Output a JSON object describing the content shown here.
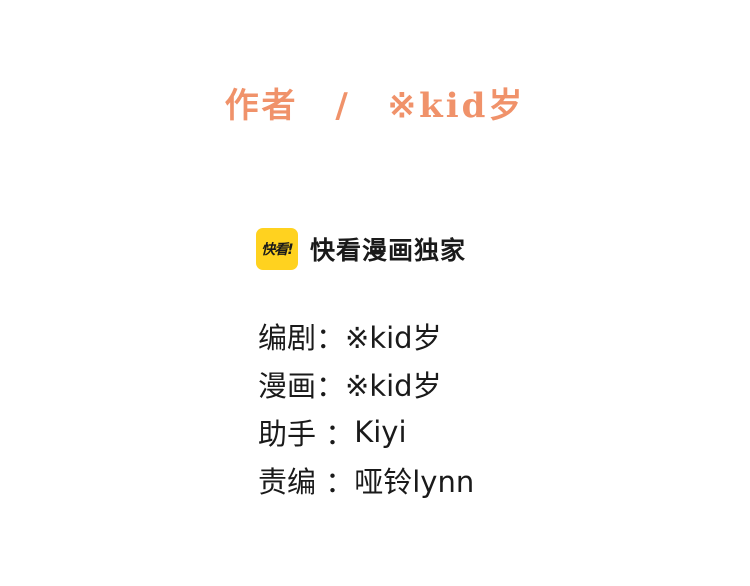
{
  "header": {
    "author_label": "作者",
    "separator": "/",
    "author_name": "※kid岁"
  },
  "brand": {
    "logo_text": "快看!",
    "title": "快看漫画独家"
  },
  "credits": [
    {
      "label": "编剧：",
      "value": "※kid岁"
    },
    {
      "label": "漫画：",
      "value": "※kid岁"
    },
    {
      "label": "助手 ： ",
      "value": "Kiyi"
    },
    {
      "label": "责编 ： ",
      "value": "哑铃lynn"
    }
  ],
  "colors": {
    "author_accent": "#f0926a",
    "brand_yellow": "#ffd21f",
    "text": "#1a1a1a"
  }
}
